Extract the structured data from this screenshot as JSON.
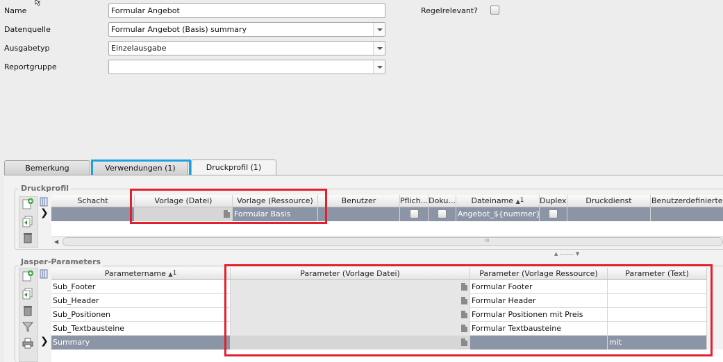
{
  "form": {
    "name_label": "Name",
    "name_value": "Formular Angebot",
    "datenquelle_label": "Datenquelle",
    "datenquelle_value": "Formular Angebot (Basis) summary",
    "ausgabetyp_label": "Ausgabetyp",
    "ausgabetyp_value": "Einzelausgabe",
    "reportgruppe_label": "Reportgruppe",
    "reportgruppe_value": "",
    "regelrelevant_label": "Regelrelevant?"
  },
  "tabs": [
    {
      "label": "Bemerkung"
    },
    {
      "label": "Verwendungen (1)"
    },
    {
      "label": "Druckprofil (1)"
    }
  ],
  "druckprofil": {
    "title": "Druckprofil",
    "columns": [
      "Schacht",
      "Vorlage (Datei)",
      "Vorlage (Ressource)",
      "Benutzer",
      "Pflich...",
      "Doku...",
      "Dateiname",
      "Duplex?",
      "Druckdienst",
      "Benutzerdefinierter Sc"
    ],
    "sort_marker": "1",
    "row": {
      "schacht": "",
      "vorlage_datei": "",
      "vorlage_ressource": "Formular Basis",
      "benutzer": "",
      "dateiname": "Angebot_${nummer}",
      "druckdienst": "",
      "benutzerdefiniert": ""
    },
    "scroll_grip": "III"
  },
  "jasper": {
    "title": "Jasper-Parameters",
    "columns": [
      "Parametername",
      "Parameter (Vorlage Datei)",
      "Parameter (Vorlage Ressource)",
      "Parameter (Text)"
    ],
    "sort_marker": "1",
    "rows": [
      {
        "name": "Sub_Footer",
        "datei": "",
        "ressource": "Formular Footer",
        "text": ""
      },
      {
        "name": "Sub_Header",
        "datei": "",
        "ressource": "Formular Header",
        "text": ""
      },
      {
        "name": "Sub_Positionen",
        "datei": "",
        "ressource": "Formular Positionen mit Preis",
        "text": ""
      },
      {
        "name": "Sub_Textbausteine",
        "datei": "",
        "ressource": "Formular Textbausteine",
        "text": ""
      },
      {
        "name": "Summary",
        "datei": "",
        "ressource": "",
        "text": "mit"
      }
    ]
  },
  "colors": {
    "highlight_red": "#e3202d",
    "highlight_blue": "#1ea0e0",
    "selected_row": "#8c95a6"
  }
}
